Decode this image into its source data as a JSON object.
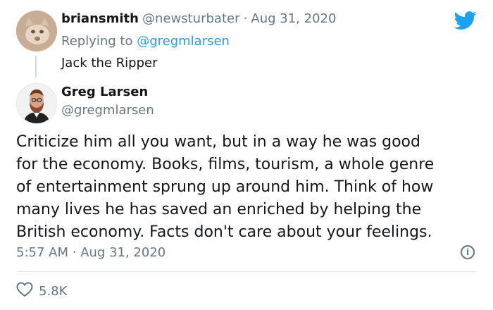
{
  "reply_tweet": {
    "author": {
      "display_name": "briansmith",
      "handle": "@newsturbater"
    },
    "separator": "·",
    "date": "Aug 31, 2020",
    "replying_to_prefix": "Replying to ",
    "replying_to_handle": "@gregmlarsen",
    "text": "Jack the Ripper"
  },
  "main_tweet": {
    "author": {
      "display_name": "Greg Larsen",
      "handle": "@gregmlarsen"
    },
    "lines": [
      "Criticize him all you want, but in a way he was good",
      "for the economy. Books, films, tourism, a whole genre",
      "of entertainment sprung up around him. Think of how",
      "many lives he has saved an enriched by helping the",
      "British economy. Facts don't care about your feelings."
    ],
    "time": "5:57 AM",
    "separator": "·",
    "date": "Aug 31, 2020",
    "likes": "5.8K"
  },
  "icons": {
    "brand": "twitter-bird-icon",
    "info": "info-icon",
    "like": "heart-icon"
  },
  "colors": {
    "brand_blue": "#1da1f2",
    "muted": "#657786",
    "text": "#14171a",
    "divider": "#e1e8ed"
  }
}
